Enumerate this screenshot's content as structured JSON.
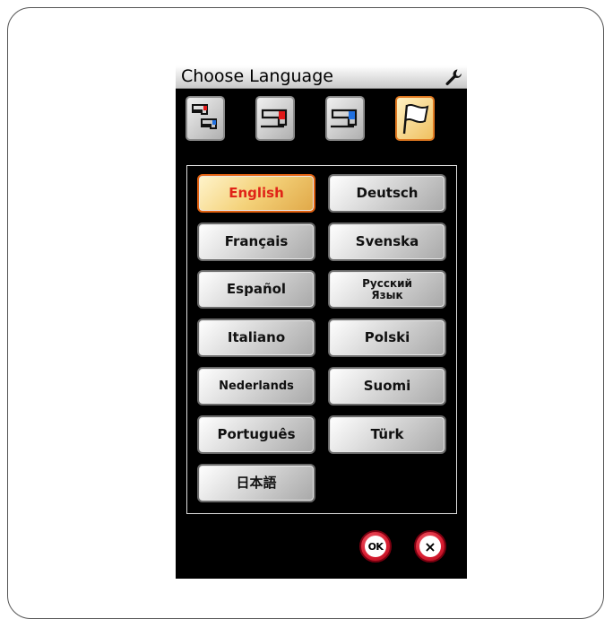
{
  "dialog": {
    "title": "Choose Language",
    "settings_icon": "wrench-icon"
  },
  "tabs": [
    {
      "icon": "machine-settings-icon",
      "active": false
    },
    {
      "icon": "sewing-settings-icon",
      "active": false
    },
    {
      "icon": "embroidery-settings-icon",
      "active": false
    },
    {
      "icon": "language-flag-icon",
      "active": true
    }
  ],
  "languages": [
    {
      "label": "English",
      "selected": true
    },
    {
      "label": "Deutsch",
      "selected": false
    },
    {
      "label": "Français",
      "selected": false
    },
    {
      "label": "Svenska",
      "selected": false
    },
    {
      "label": "Español",
      "selected": false
    },
    {
      "label": "Русский\nЯзык",
      "selected": false
    },
    {
      "label": "Italiano",
      "selected": false
    },
    {
      "label": "Polski",
      "selected": false
    },
    {
      "label": "Nederlands",
      "selected": false
    },
    {
      "label": "Suomi",
      "selected": false
    },
    {
      "label": "Português",
      "selected": false
    },
    {
      "label": "Türk",
      "selected": false
    },
    {
      "label": "日本語",
      "selected": false
    }
  ],
  "actions": {
    "ok_label": "OK",
    "cancel_label": "×"
  },
  "colors": {
    "selected_text": "#e02418",
    "selected_border": "#e06010",
    "action_red": "#d81c30"
  }
}
